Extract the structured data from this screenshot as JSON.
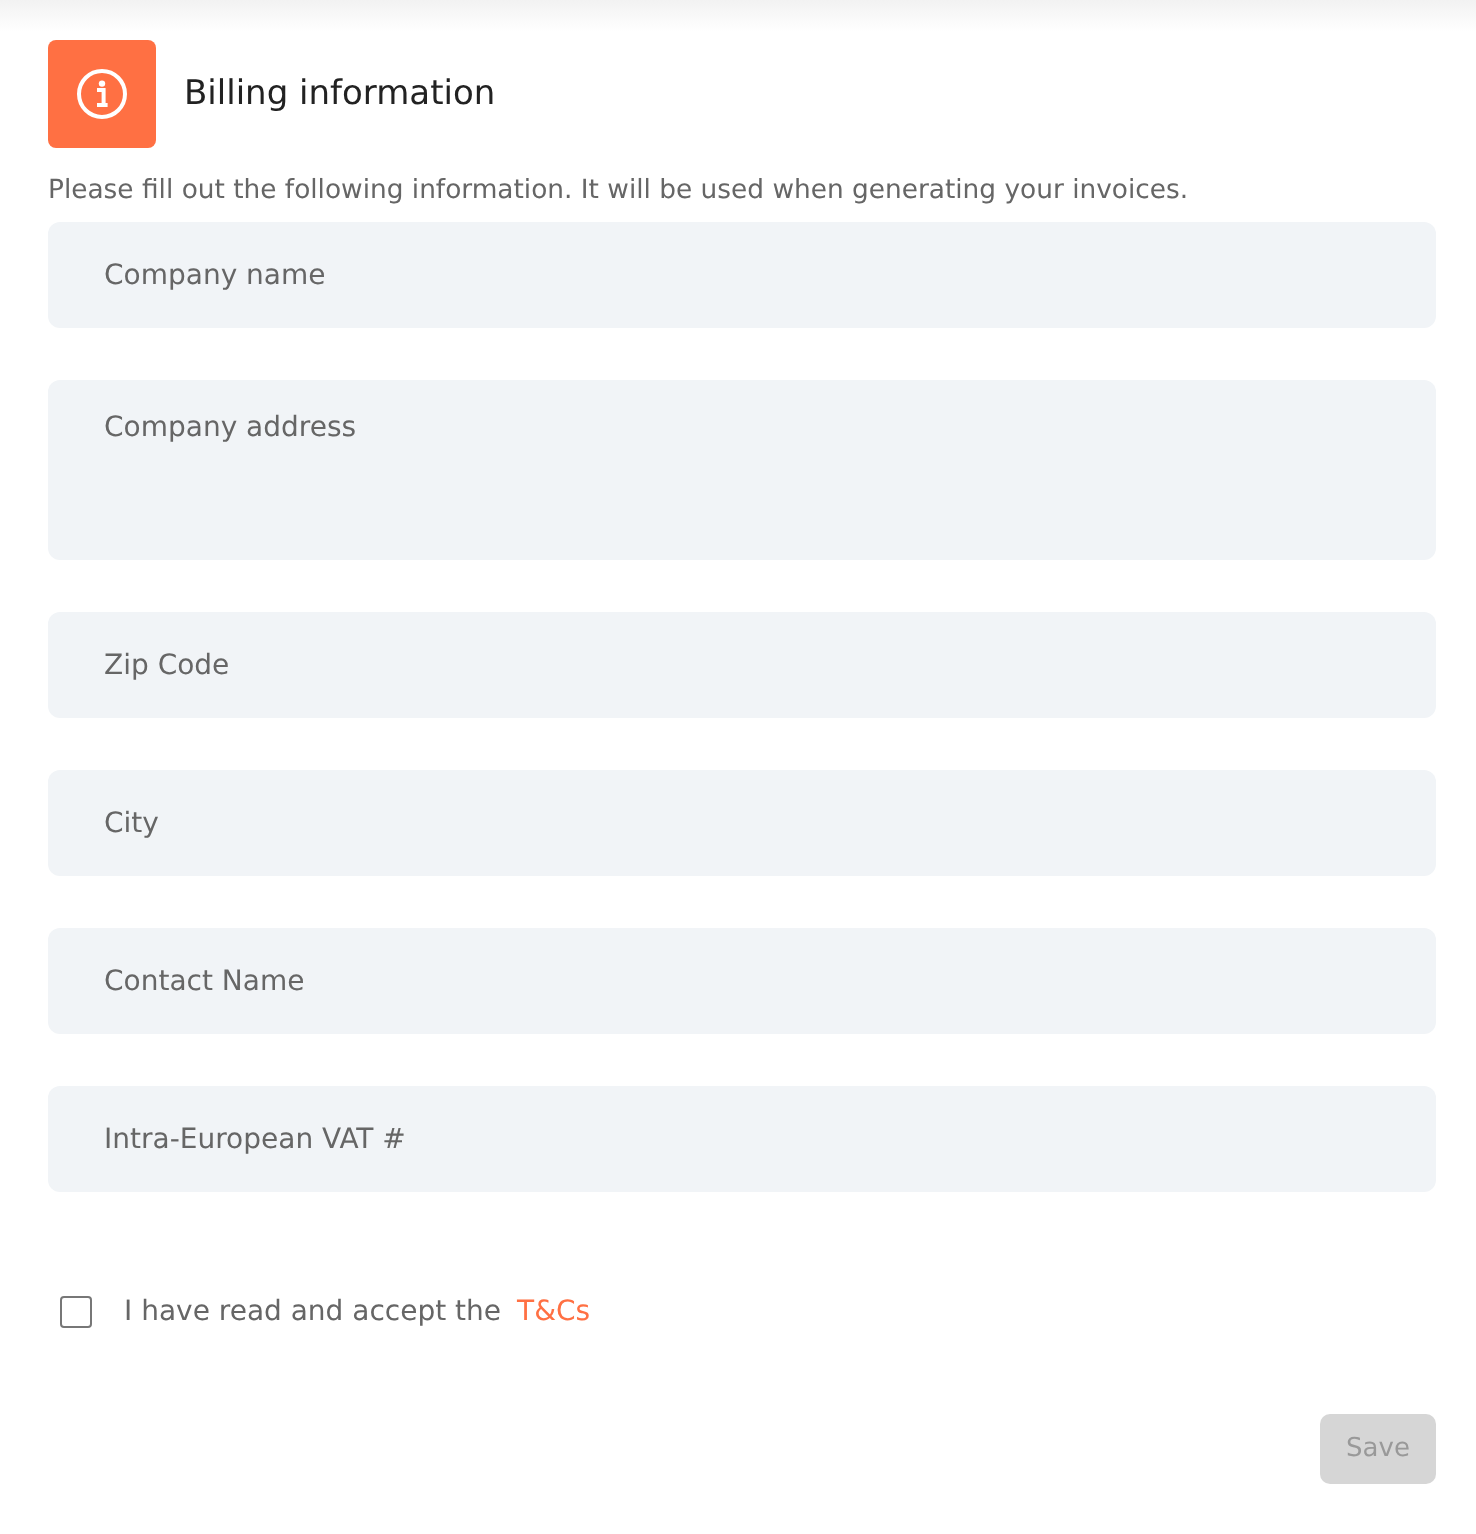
{
  "header": {
    "title": "Billing information"
  },
  "description": "Please fill out the following information. It will be used when generating your invoices.",
  "fields": [
    {
      "kind": "input",
      "placeholder": "Company name"
    },
    {
      "kind": "textarea",
      "placeholder": "Company address"
    },
    {
      "kind": "input",
      "placeholder": "Zip Code"
    },
    {
      "kind": "input",
      "placeholder": "City"
    },
    {
      "kind": "input",
      "placeholder": "Contact Name"
    },
    {
      "kind": "input",
      "placeholder": "Intra-European VAT #"
    }
  ],
  "terms": {
    "checked": false,
    "label": "I have read and accept the",
    "link": "T&Cs"
  },
  "save_button": {
    "label": "Save",
    "disabled": true
  }
}
